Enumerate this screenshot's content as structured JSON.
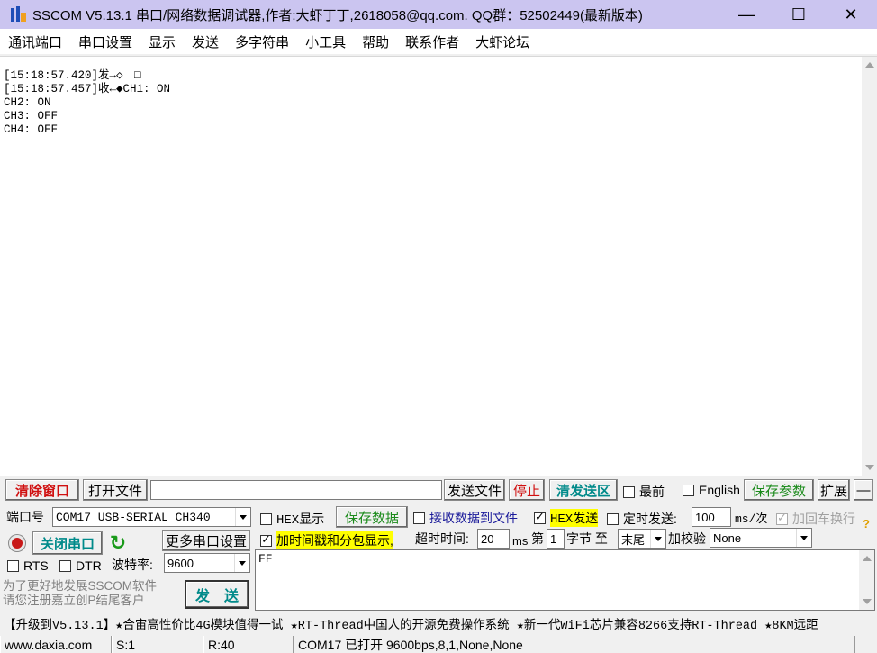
{
  "window": {
    "title": "SSCOM V5.13.1 串口/网络数据调试器,作者:大虾丁丁,2618058@qq.com. QQ群：52502449(最新版本)",
    "minimize": "—",
    "maximize": "☐",
    "close": "✕"
  },
  "menu": [
    "通讯端口",
    "串口设置",
    "显示",
    "发送",
    "多字符串",
    "小工具",
    "帮助",
    "联系作者",
    "大虾论坛"
  ],
  "output": {
    "lines": [
      "[15:18:57.420]发→◇　□",
      "[15:18:57.457]收←◆CH1: ON",
      "CH2: ON",
      "CH3: OFF",
      "CH4: OFF"
    ]
  },
  "toolbar": {
    "clear_window": "清除窗口",
    "open_file": "打开文件",
    "file_path": "",
    "send_file": "发送文件",
    "stop": "停止",
    "clear_send": "清发送区",
    "topmost": "最前",
    "english": "English",
    "save_params": "保存参数",
    "expand": "扩展",
    "collapse": "—"
  },
  "port": {
    "label": "端口号",
    "value": "COM17 USB-SERIAL CH340",
    "close_port": "关闭串口",
    "more_settings": "更多串口设置",
    "rts": "RTS",
    "dtr": "DTR",
    "baud_label": "波特率:",
    "baud": "9600"
  },
  "options": {
    "hex_display": "HEX显示",
    "save_data": "保存数据",
    "recv_to_file": "接收数据到文件",
    "hex_send": "HEX发送",
    "timed_send": "定时发送:",
    "interval": "100",
    "interval_unit": "ms/次",
    "add_crlf": "加回车换行",
    "timestamp": "加时间戳和分包显示,",
    "timeout_label": "超时时间:",
    "timeout": "20",
    "ms": "ms",
    "byte_prefix": "第",
    "byte_index": "1",
    "byte_suffix": "字节 至",
    "byte_to": "末尾",
    "checksum_label": "加校验",
    "checksum": "None"
  },
  "send": {
    "content": "FF",
    "button": "发　送",
    "promo": "为了更好地发展SSCOM软件\n请您注册嘉立创P结尾客户"
  },
  "marquee": "【升级到V5.13.1】★合宙高性价比4G模块值得一试 ★RT-Thread中国人的开源免费操作系统 ★新一代WiFi芯片兼容8266支持RT-Thread ★8KM远距",
  "status": {
    "site": "www.daxia.com",
    "sent": "S:1",
    "recv": "R:40",
    "port_status": "COM17 已打开  9600bps,8,1,None,None"
  },
  "colors": {
    "titlebar": "#cbc5f0",
    "accent_red": "#d01010",
    "accent_teal": "#008a8a",
    "highlight": "#ffff00"
  }
}
